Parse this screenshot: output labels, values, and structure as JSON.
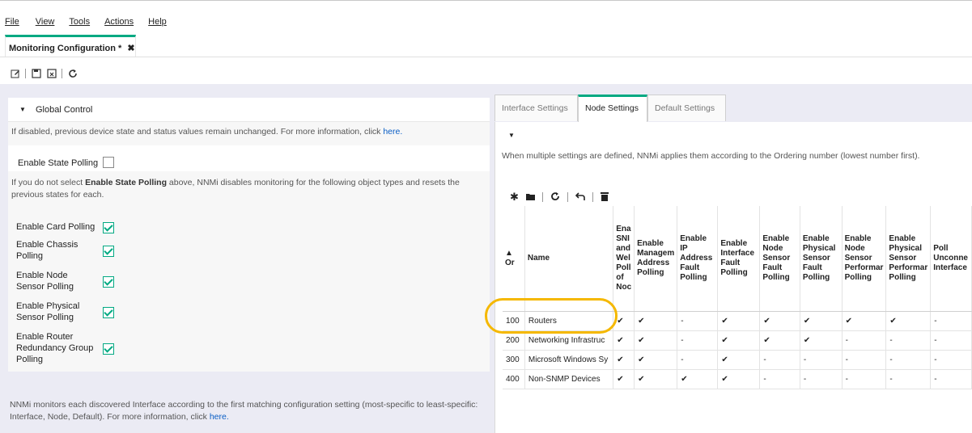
{
  "menu": [
    "File",
    "View",
    "Tools",
    "Actions",
    "Help"
  ],
  "doc_tab": {
    "title": "Monitoring Configuration *",
    "close_glyph": "✖"
  },
  "toolbar": {
    "icons": [
      "edit-icon",
      "save-icon",
      "save-close-icon",
      "refresh-icon"
    ]
  },
  "global_control": {
    "title": "Global Control",
    "info_text": "If disabled, previous device state and status values remain unchanged. For more information, click ",
    "info_link": "here.",
    "enable_state_polling": {
      "label": "Enable State Polling",
      "checked": false
    },
    "note_prefix": "If you do not select ",
    "note_bold": "Enable State Polling",
    "note_suffix": " above, NNMi disables monitoring for the following object types and resets the previous states for each.",
    "options": [
      {
        "label": "Enable Card Polling",
        "checked": true
      },
      {
        "label": "Enable Chassis Polling",
        "checked": true
      },
      {
        "label": "Enable Node Sensor Polling",
        "checked": true
      },
      {
        "label": "Enable Physical Sensor Polling",
        "checked": true
      },
      {
        "label": "Enable Router Redundancy Group Polling",
        "checked": true
      }
    ],
    "footer_text": "NNMi monitors each discovered Interface according to the first matching configuration setting (most-specific to least-specific: Interface, Node, Default). For more information, click ",
    "footer_link": "here."
  },
  "right_tabs": [
    "Interface Settings",
    "Node Settings",
    "Default Settings"
  ],
  "active_tab": "Node Settings",
  "node_settings": {
    "ordering_note": "When multiple settings are defined, NNMi applies them according to the Ordering number (lowest number first).",
    "columns": [
      "▲ Or",
      "Name",
      "Ena SNI and Wel Poll of Noc",
      "Enable Managem Address Polling",
      "Enable IP Address Fault Polling",
      "Enable Interface Fault Polling",
      "Enable Node Sensor Fault Polling",
      "Enable Physical Sensor Fault Polling",
      "Enable Node Sensor Performar Polling",
      "Enable Physical Sensor Performar Polling",
      "Poll Unconne Interface"
    ],
    "rows": [
      [
        "100",
        "Routers",
        "✔",
        "✔",
        "-",
        "✔",
        "✔",
        "✔",
        "✔",
        "✔",
        "-"
      ],
      [
        "200",
        "Networking Infrastruc",
        "✔",
        "✔",
        "-",
        "✔",
        "✔",
        "✔",
        "-",
        "-",
        "-"
      ],
      [
        "300",
        "Microsoft Windows Sy",
        "✔",
        "✔",
        "-",
        "✔",
        "-",
        "-",
        "-",
        "-",
        "-"
      ],
      [
        "400",
        "Non-SNMP Devices",
        "✔",
        "✔",
        "✔",
        "✔",
        "-",
        "-",
        "-",
        "-",
        "-"
      ]
    ]
  },
  "colors": {
    "accent": "#01a982",
    "highlight": "#f5b800",
    "link": "#0a5ec5"
  }
}
